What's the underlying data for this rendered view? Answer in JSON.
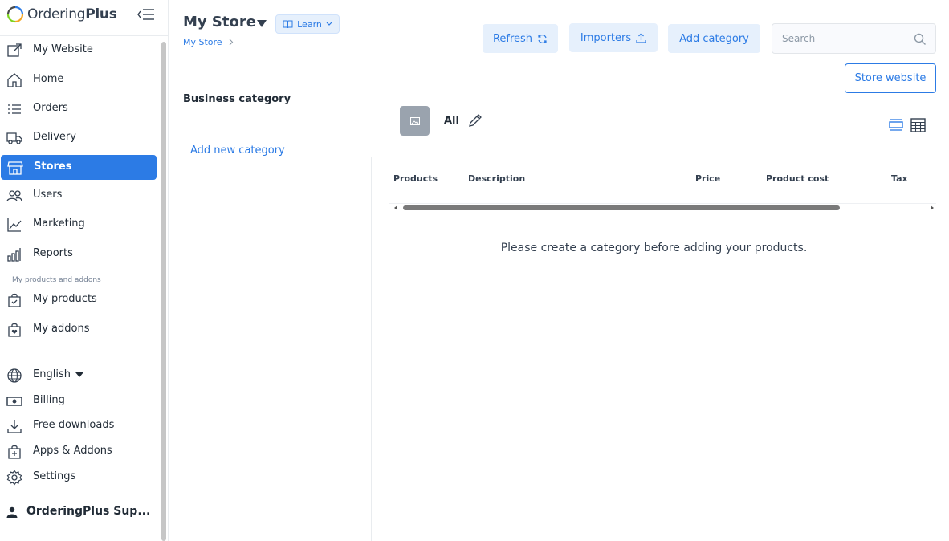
{
  "brand": {
    "name_part1": "Ordering",
    "name_part2": "Plus"
  },
  "sidebar": {
    "items": [
      {
        "label": "My Website",
        "icon": "external-link-icon"
      },
      {
        "label": "Home",
        "icon": "home-icon"
      },
      {
        "label": "Orders",
        "icon": "list-icon"
      },
      {
        "label": "Delivery",
        "icon": "truck-icon"
      },
      {
        "label": "Stores",
        "icon": "store-icon",
        "active": true
      },
      {
        "label": "Users",
        "icon": "users-icon"
      },
      {
        "label": "Marketing",
        "icon": "line-chart-icon"
      },
      {
        "label": "Reports",
        "icon": "bar-chart-icon"
      }
    ],
    "section_label": "My products and addons",
    "product_items": [
      {
        "label": "My products",
        "icon": "bag-check-icon"
      },
      {
        "label": "My addons",
        "icon": "bag-heart-icon"
      }
    ],
    "bottom_items": [
      {
        "label": "English",
        "icon": "globe-icon"
      },
      {
        "label": "Billing",
        "icon": "cash-icon"
      },
      {
        "label": "Free downloads",
        "icon": "download-icon"
      },
      {
        "label": "Apps & Addons",
        "icon": "bag-plus-icon"
      },
      {
        "label": "Settings",
        "icon": "gear-icon"
      }
    ],
    "user_name": "OrderingPlus Sup..."
  },
  "header": {
    "store_title": "My Store",
    "learn_label": "Learn",
    "breadcrumb": "My Store",
    "refresh_label": "Refresh",
    "importers_label": "Importers",
    "add_category_label": "Add category",
    "search_placeholder": "Search",
    "store_website_label": "Store website"
  },
  "content": {
    "business_category": "Business category",
    "add_new_category": "Add new category",
    "category_all": "All",
    "table_headers": [
      "Products",
      "Description",
      "Price",
      "Product cost",
      "Tax"
    ],
    "empty_message": "Please create a category before adding your products."
  },
  "colors": {
    "accent": "#2c7be5",
    "accent_soft": "#e6f0fc",
    "text": "#344050"
  }
}
